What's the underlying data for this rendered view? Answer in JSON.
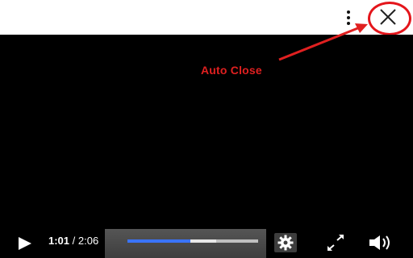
{
  "annotation": {
    "text": "Auto Close",
    "color": "#e02020"
  },
  "topbar": {
    "menu_icon": "kebab-menu-icon",
    "close_icon": "close-icon"
  },
  "player": {
    "current_time": "1:01",
    "duration": "/ 2:06",
    "progress_fraction": 0.48,
    "buffered_fraction": 0.68,
    "accent_color": "#3a74ff",
    "icons": [
      "play-icon",
      "settings-gear-icon",
      "fullscreen-icon",
      "volume-icon"
    ]
  }
}
